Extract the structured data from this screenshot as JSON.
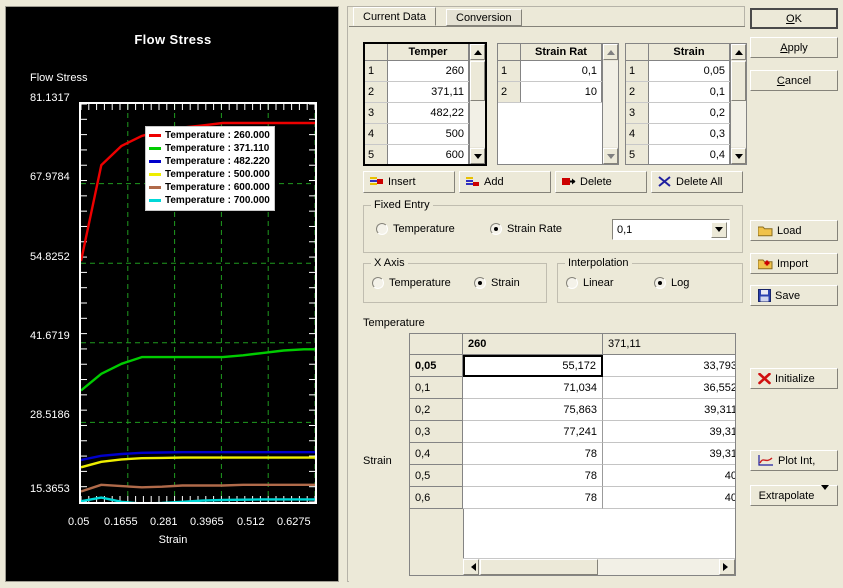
{
  "chart": {
    "title": "Flow Stress",
    "y_axis_label": "Flow Stress",
    "x_axis_label": "Strain",
    "y_ticks": [
      "81.1317",
      "67.9784",
      "54.8252",
      "41.6719",
      "28.5186",
      "15.3653"
    ],
    "x_ticks": [
      "0.05",
      "0.1655",
      "0.281",
      "0.3965",
      "0.512",
      "0.6275"
    ],
    "legend": [
      {
        "label": "Temperature : 260.000",
        "color": "#ee0000"
      },
      {
        "label": "Temperature : 371.110",
        "color": "#00cc00"
      },
      {
        "label": "Temperature : 482.220",
        "color": "#0000cc"
      },
      {
        "label": "Temperature : 500.000",
        "color": "#eeee00"
      },
      {
        "label": "Temperature : 600.000",
        "color": "#b06a4a"
      },
      {
        "label": "Temperature : 700.000",
        "color": "#00d8d8"
      }
    ]
  },
  "chart_data": {
    "type": "line",
    "title": "Flow Stress",
    "xlabel": "Strain",
    "ylabel": "Flow Stress",
    "xlim": [
      0.05,
      0.6275
    ],
    "ylim": [
      15.3653,
      81.1317
    ],
    "grid": true,
    "legend_position": "inside-top-left",
    "x": [
      0.05,
      0.1,
      0.15,
      0.2,
      0.25,
      0.3,
      0.35,
      0.4,
      0.45,
      0.5,
      0.55,
      0.6,
      0.6275
    ],
    "series": [
      {
        "name": "Temperature : 260.000",
        "color": "#ee0000",
        "values": [
          55.17,
          71.03,
          74.2,
          75.86,
          76.7,
          77.24,
          77.6,
          78.0,
          78.0,
          78.0,
          78.0,
          78.0,
          78.0
        ]
      },
      {
        "name": "Temperature : 371.110",
        "color": "#00cc00",
        "values": [
          33.79,
          36.55,
          38.2,
          39.31,
          39.31,
          39.31,
          39.31,
          39.31,
          39.6,
          40.0,
          40.4,
          40.6,
          40.6
        ]
      },
      {
        "name": "Temperature : 482.220",
        "color": "#0000cc",
        "values": [
          22.3,
          23.0,
          23.3,
          23.5,
          23.55,
          23.6,
          23.6,
          23.6,
          23.6,
          23.6,
          23.6,
          23.6,
          23.6
        ]
      },
      {
        "name": "Temperature : 500.000",
        "color": "#eeee00",
        "values": [
          21.1,
          22.0,
          22.4,
          22.6,
          22.65,
          22.7,
          22.7,
          22.7,
          22.7,
          22.7,
          22.7,
          22.7,
          22.7
        ]
      },
      {
        "name": "Temperature : 600.000",
        "color": "#b06a4a",
        "values": [
          17.1,
          18.2,
          18.0,
          17.8,
          17.9,
          18.1,
          18.1,
          18.1,
          18.2,
          18.2,
          18.2,
          18.2,
          18.2
        ]
      },
      {
        "name": "Temperature : 700.000",
        "color": "#00d8d8",
        "values": [
          15.5,
          16.1,
          15.4,
          15.1,
          15.2,
          15.4,
          15.6,
          15.7,
          15.75,
          15.8,
          15.8,
          15.8,
          15.8
        ]
      }
    ]
  },
  "tabs": [
    {
      "label": "Current Data",
      "active": true
    },
    {
      "label": "Conversion",
      "active": false
    }
  ],
  "grids": {
    "temperature": {
      "header": "Temper",
      "rows": [
        {
          "n": "1",
          "v": "260"
        },
        {
          "n": "2",
          "v": "371,11"
        },
        {
          "n": "3",
          "v": "482,22"
        },
        {
          "n": "4",
          "v": "500"
        },
        {
          "n": "5",
          "v": "600"
        }
      ]
    },
    "strain_rate": {
      "header": "Strain Rat",
      "rows": [
        {
          "n": "1",
          "v": "0,1"
        },
        {
          "n": "2",
          "v": "10"
        }
      ]
    },
    "strain": {
      "header": "Strain",
      "rows": [
        {
          "n": "1",
          "v": "0,05"
        },
        {
          "n": "2",
          "v": "0,1"
        },
        {
          "n": "3",
          "v": "0,2"
        },
        {
          "n": "4",
          "v": "0,3"
        },
        {
          "n": "5",
          "v": "0,4"
        }
      ]
    }
  },
  "row_buttons": [
    {
      "label": "Insert",
      "icon": "insert-row-icon"
    },
    {
      "label": "Add",
      "icon": "add-row-icon"
    },
    {
      "label": "Delete",
      "icon": "delete-row-icon"
    },
    {
      "label": "Delete All",
      "icon": "delete-all-icon"
    }
  ],
  "fixed_entry": {
    "title": "Fixed Entry",
    "options": [
      {
        "label": "Temperature",
        "selected": false
      },
      {
        "label": "Strain Rate",
        "selected": true
      }
    ],
    "combo_value": "0,1"
  },
  "x_axis_group": {
    "title": "X Axis",
    "options": [
      {
        "label": "Temperature",
        "selected": false
      },
      {
        "label": "Strain",
        "selected": true
      }
    ]
  },
  "interpolation_group": {
    "title": "Interpolation",
    "options": [
      {
        "label": "Linear",
        "selected": false
      },
      {
        "label": "Log",
        "selected": true
      }
    ]
  },
  "data_table": {
    "top_label": "Temperature",
    "side_label": "Strain",
    "columns": [
      {
        "label": "260",
        "selected": true
      },
      {
        "label": "371,11",
        "selected": false
      }
    ],
    "rows": [
      {
        "header": "0,05",
        "selected": true,
        "cells": [
          "55,172",
          "33,793"
        ]
      },
      {
        "header": "0,1",
        "selected": false,
        "cells": [
          "71,034",
          "36,552"
        ]
      },
      {
        "header": "0,2",
        "selected": false,
        "cells": [
          "75,863",
          "39,311"
        ]
      },
      {
        "header": "0,3",
        "selected": false,
        "cells": [
          "77,241",
          "39,31"
        ]
      },
      {
        "header": "0,4",
        "selected": false,
        "cells": [
          "78",
          "39,31"
        ]
      },
      {
        "header": "0,5",
        "selected": false,
        "cells": [
          "78",
          "40"
        ]
      },
      {
        "header": "0,6",
        "selected": false,
        "cells": [
          "78",
          "40"
        ]
      }
    ]
  },
  "side_buttons": [
    {
      "label": "OK",
      "accel": "O",
      "icon": null,
      "default": true
    },
    {
      "label": "Apply",
      "accel": "A",
      "icon": null,
      "default": false
    },
    {
      "label": "Cancel",
      "accel": "C",
      "icon": null,
      "default": false
    },
    {
      "label": "Load",
      "icon": "folder-icon"
    },
    {
      "label": "Import",
      "icon": "import-icon"
    },
    {
      "label": "Save",
      "icon": "floppy-disk-icon"
    },
    {
      "label": "Initialize",
      "icon": "red-x-icon"
    },
    {
      "label": "Plot Int,",
      "icon": "plot-icon"
    },
    {
      "label": "Extrapolate",
      "icon": "chevron-down-icon"
    }
  ]
}
